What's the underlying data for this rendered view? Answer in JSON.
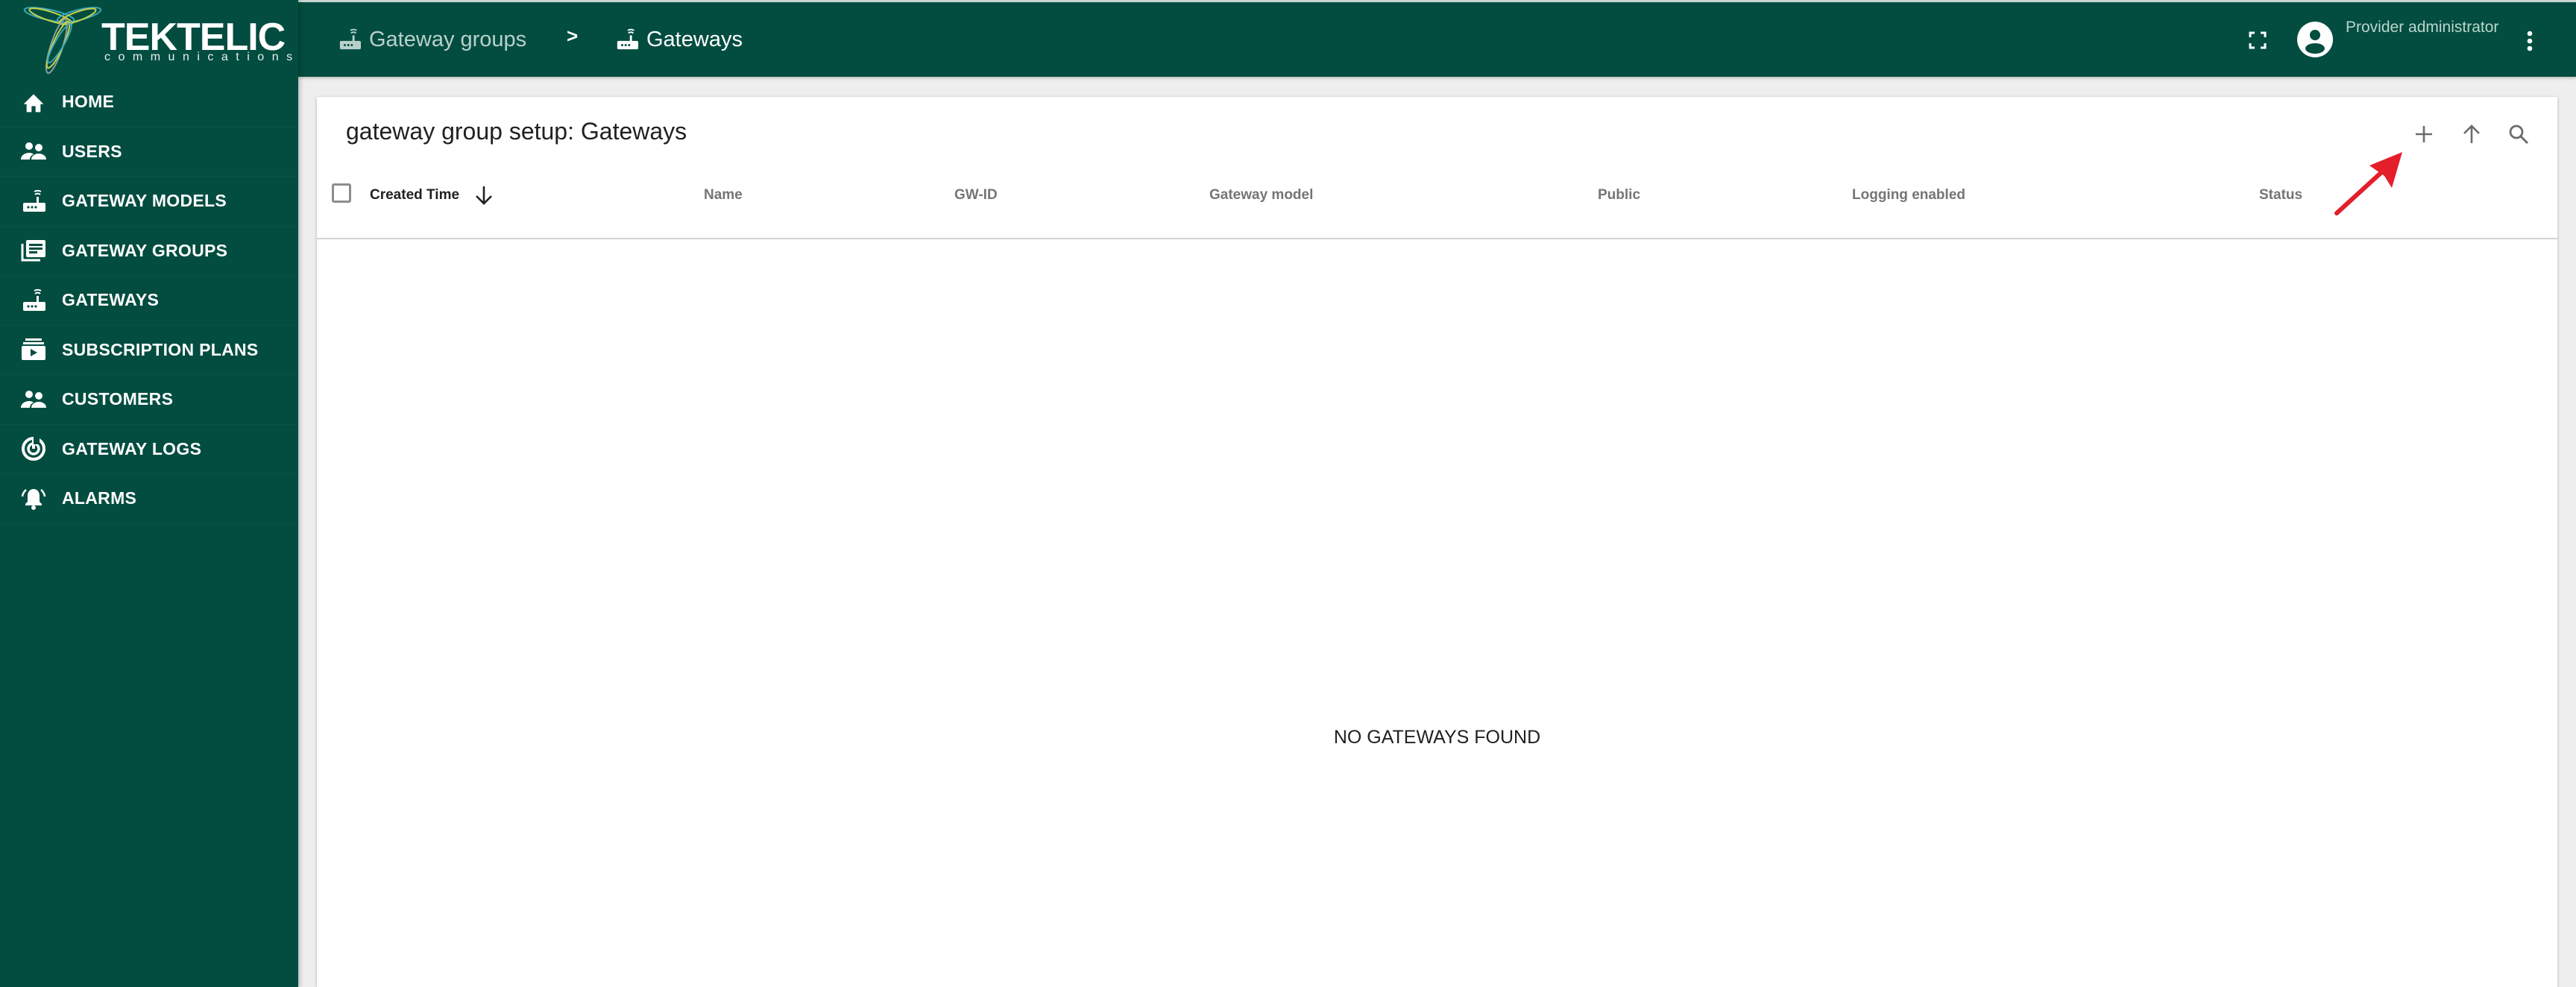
{
  "brand": {
    "name": "TEKTELIC",
    "tagline": "communications",
    "primary_color": "#024d40",
    "accent_color": "#e41e2b"
  },
  "sidebar": {
    "items": [
      {
        "label": "HOME",
        "icon": "home-icon"
      },
      {
        "label": "USERS",
        "icon": "users-icon"
      },
      {
        "label": "GATEWAY MODELS",
        "icon": "router-icon"
      },
      {
        "label": "GATEWAY GROUPS",
        "icon": "library-books-icon"
      },
      {
        "label": "GATEWAYS",
        "icon": "router-icon"
      },
      {
        "label": "SUBSCRIPTION PLANS",
        "icon": "subscriptions-icon"
      },
      {
        "label": "CUSTOMERS",
        "icon": "users-icon"
      },
      {
        "label": "GATEWAY LOGS",
        "icon": "track-changes-icon"
      },
      {
        "label": "ALARMS",
        "icon": "notifications-active-icon"
      }
    ]
  },
  "header": {
    "breadcrumb": [
      {
        "label": "Gateway groups",
        "icon": "router-icon"
      },
      {
        "label": "Gateways",
        "icon": "router-icon"
      }
    ],
    "separator": ">",
    "user_label": "Provider administrator",
    "fullscreen_icon": "fullscreen-icon",
    "avatar_icon": "account-circle-icon",
    "more_icon": "more-vert-icon"
  },
  "card": {
    "title": "gateway group setup: Gateways",
    "toolbar": [
      {
        "name": "add",
        "icon": "plus-icon"
      },
      {
        "name": "upload",
        "icon": "arrow-up-icon"
      },
      {
        "name": "search",
        "icon": "search-icon"
      }
    ],
    "columns": [
      {
        "label": "Created Time",
        "sorted": "descending"
      },
      {
        "label": "Name"
      },
      {
        "label": "GW-ID"
      },
      {
        "label": "Gateway model"
      },
      {
        "label": "Public"
      },
      {
        "label": "Logging enabled"
      },
      {
        "label": "Status"
      }
    ],
    "rows": [],
    "empty_message": "NO GATEWAYS FOUND"
  }
}
